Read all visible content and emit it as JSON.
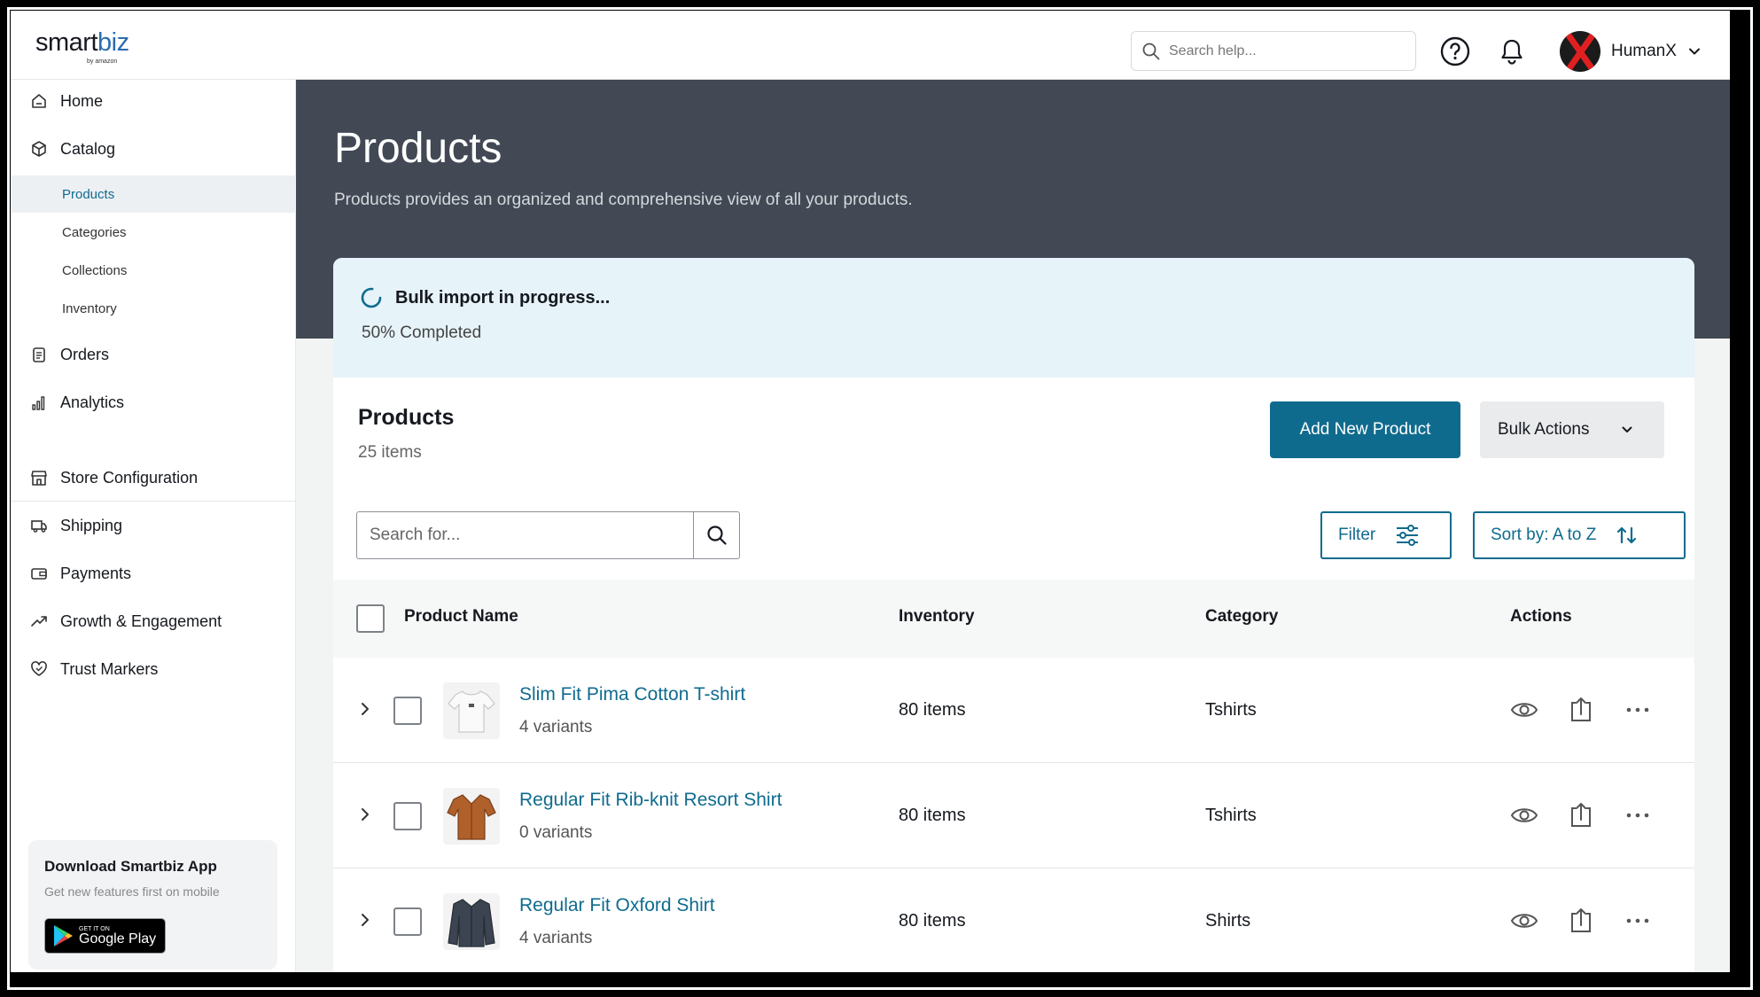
{
  "header": {
    "logo_main_a": "sm",
    "logo_main_b": "art",
    "logo_main_c": "biz",
    "logo_sub": "by amazon",
    "search_placeholder": "Search help...",
    "user_name": "HumanX"
  },
  "sidebar": {
    "items": [
      {
        "label": "Home",
        "icon": "home-icon"
      },
      {
        "label": "Catalog",
        "icon": "box-icon"
      },
      {
        "label": "Orders",
        "icon": "clipboard-icon"
      },
      {
        "label": "Analytics",
        "icon": "bar-chart-icon"
      },
      {
        "label": "Store Configuration",
        "icon": "store-icon"
      },
      {
        "label": "Shipping",
        "icon": "truck-icon"
      },
      {
        "label": "Payments",
        "icon": "wallet-icon"
      },
      {
        "label": "Growth & Engagement",
        "icon": "trending-up-icon"
      },
      {
        "label": "Trust Markers",
        "icon": "heart-shield-icon"
      }
    ],
    "catalog_sub": [
      "Products",
      "Categories",
      "Collections",
      "Inventory"
    ],
    "active_sub": "Products",
    "app_card": {
      "title": "Download Smartbiz App",
      "subtitle": "Get new features first on mobile",
      "store_small": "GET IT ON",
      "store_big": "Google Play"
    }
  },
  "page": {
    "title": "Products",
    "description": "Products provides an organized and comprehensive view of all your products."
  },
  "banner": {
    "title": "Bulk import in progress...",
    "status": "50% Completed",
    "progress_percent": 50
  },
  "products_section": {
    "title": "Products",
    "count": "25 items",
    "add_button": "Add New Product",
    "bulk_button": "Bulk Actions",
    "search_placeholder": "Search for...",
    "filter_label": "Filter",
    "sort_label": "Sort by: A to Z"
  },
  "table": {
    "columns": [
      "Product Name",
      "Inventory",
      "Category",
      "Actions"
    ],
    "rows": [
      {
        "name": "Slim Fit Pima Cotton T-shirt",
        "variants": "4 variants",
        "inventory": "80 items",
        "category": "Tshirts",
        "thumb": "white-tshirt"
      },
      {
        "name": "Regular Fit Rib-knit Resort Shirt",
        "variants": "0 variants",
        "inventory": "80 items",
        "category": "Tshirts",
        "thumb": "brown-shirt"
      },
      {
        "name": "Regular Fit Oxford Shirt",
        "variants": "4 variants",
        "inventory": "80 items",
        "category": "Shirts",
        "thumb": "navy-shirt"
      }
    ]
  },
  "colors": {
    "accent": "#0f6b8e",
    "hero_bg": "#424955",
    "banner_bg": "#e6f3f9"
  }
}
